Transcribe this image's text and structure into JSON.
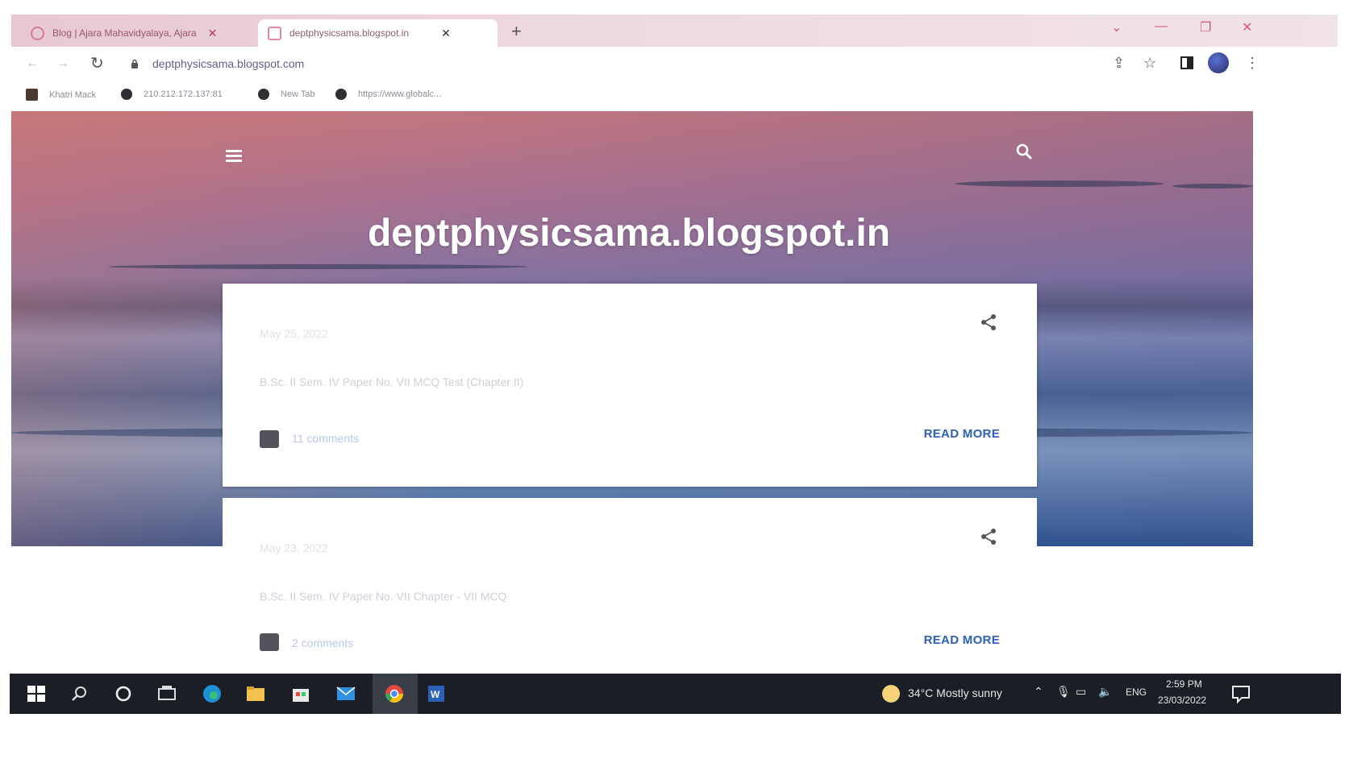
{
  "browser": {
    "tabs": [
      {
        "title": "Blog | Ajara Mahavidyalaya, Ajara",
        "active": false
      },
      {
        "title": "deptphysicsama.blogspot.in",
        "active": true
      }
    ],
    "new_tab_icon": "+",
    "url": "deptphysicsama.blogspot.com",
    "bookmarks": [
      {
        "label": "Khatri Mack",
        "icon": "favicon"
      },
      {
        "label": "210.212.172.137:81",
        "icon": "globe-icon"
      },
      {
        "label": "New Tab",
        "icon": "globe-icon"
      },
      {
        "label": "https://www.globalc...",
        "icon": "globe-icon"
      }
    ]
  },
  "blog": {
    "title": "deptphysicsama.blogspot.in",
    "posts": [
      {
        "date": "May 25, 2022",
        "title": "B.Sc. II Sem. IV Paper No. VII MCQ Test (Chapter II)",
        "comments": "11 comments",
        "read_more": "READ MORE"
      },
      {
        "date": "May 23, 2022",
        "title": "B.Sc. II Sem. IV Paper No. VII Chapter - VII MCQ",
        "comments": "2 comments",
        "read_more": "READ MORE"
      }
    ]
  },
  "taskbar": {
    "weather": "34°C  Mostly sunny",
    "language": "ENG",
    "time": "2:59 PM",
    "date": "23/03/2022"
  },
  "colors": {
    "read_more": "#2d5fb8",
    "taskbar": "#1b1e24",
    "tab_accent": "#d15b78"
  }
}
